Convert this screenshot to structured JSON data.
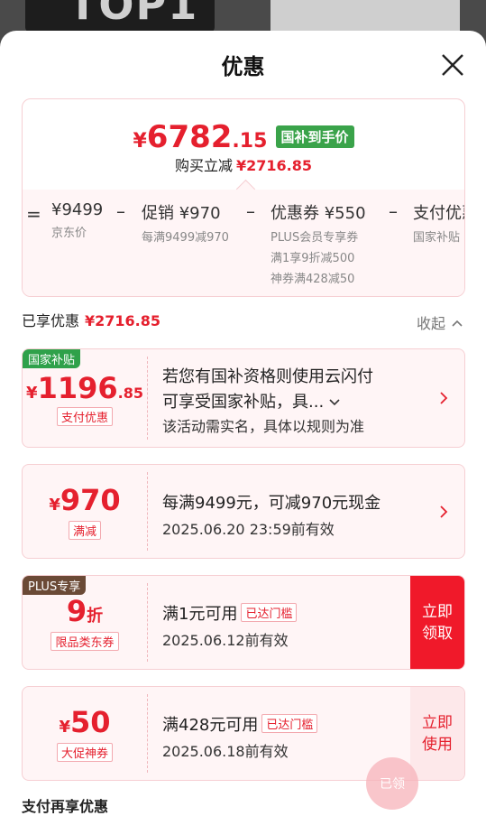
{
  "background": {
    "badge_text": "TOP1"
  },
  "header": {
    "title": "优惠"
  },
  "summary": {
    "price_symbol": "¥",
    "price_int": "6782",
    "price_dec": ".15",
    "price_tag": "国补到手价",
    "buy_label": "购买立减",
    "buy_amount": "¥2716.85",
    "breakdown": [
      {
        "op": "=",
        "main": "¥9499",
        "sub": "京东价"
      },
      {
        "op": "–",
        "main": "促销 ¥970",
        "sub": "每满9499减970"
      },
      {
        "op": "–",
        "main": "优惠券 ¥550",
        "sub": "PLUS会员专享券",
        "sub2": "满1享9折减500",
        "sub3": "神券满428减50"
      },
      {
        "op": "–",
        "main": "支付优惠",
        "sub": "国家补贴"
      }
    ]
  },
  "enjoyed": {
    "label": "已享优惠",
    "amount": "¥2716.85",
    "collapse_label": "收起"
  },
  "coupons": [
    {
      "corner": "国家补贴",
      "yen": "¥",
      "big": "1196",
      "dec": ".85",
      "type": "支付优惠",
      "line1": "若您有国补资格则使用云闪付",
      "line2": "可享受国家补贴，具...",
      "line3": "该活动需实名，具体以规则为准"
    },
    {
      "yen": "¥",
      "big": "970",
      "type": "满减",
      "line1": "每满9499元，可减970元现金",
      "line2": "2025.06.20 23:59前有效"
    },
    {
      "corner": "PLUS专享",
      "big": "9",
      "unit": "折",
      "type": "限品类东券",
      "line1": "满1元可用",
      "badge": "已达门槛",
      "line2": "2025.06.12前有效",
      "button": "立即领取"
    },
    {
      "yen": "¥",
      "big": "50",
      "type": "大促神券",
      "line1": "满428元可用",
      "badge": "已达门槛",
      "line2": "2025.06.18前有效",
      "button": "立即使用"
    }
  ],
  "stamp_text": "已领",
  "footer": {
    "label": "支付再享优惠"
  },
  "colors": {
    "accent": "#e5202e",
    "green_tag": "#3aa34a",
    "gov_tag": "#2fa14a",
    "plus_tag": "#6b4a36"
  }
}
